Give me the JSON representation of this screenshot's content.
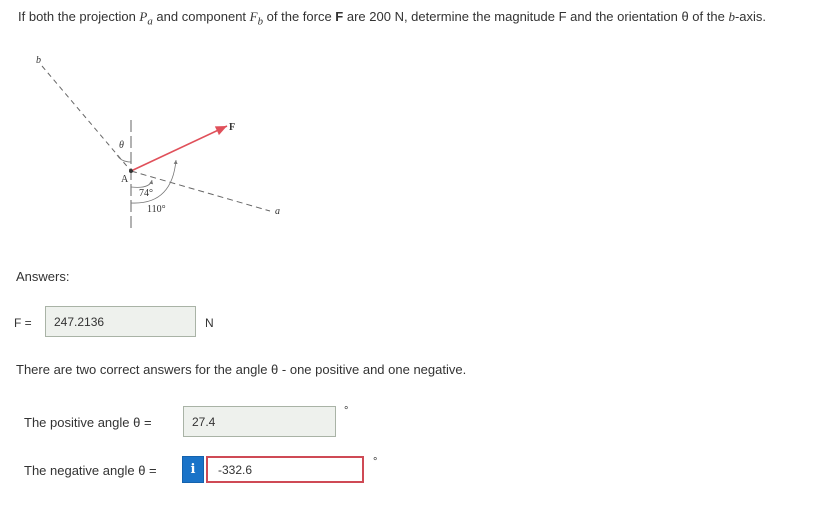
{
  "problem": {
    "part1": "If both the projection ",
    "p_symbol": "P",
    "p_sub": "a",
    "part2": " and component ",
    "f_symbol": "F",
    "f_sub": "b",
    "part3": " of the force ",
    "force_bold": "F",
    "part4": " are 200 N, determine the magnitude F and the orientation θ of the ",
    "b_axis": "b",
    "part5": "-axis."
  },
  "diagram": {
    "label_b": "b",
    "label_a": "a",
    "label_f": "F",
    "label_A": "A",
    "label_theta": "θ",
    "angle_74": "74°",
    "angle_110": "110°",
    "colors": {
      "force": "#e0505a",
      "axis": "#555555"
    }
  },
  "answers_label": "Answers:",
  "f_row": {
    "label": "F =",
    "value": "247.2136",
    "unit": "N"
  },
  "note": "There are two correct answers for the angle θ - one positive and one negative.",
  "positive": {
    "label": "The positive angle θ =",
    "value": "27.4",
    "unit": "°"
  },
  "negative": {
    "label": "The negative angle θ =",
    "value": "-332.6",
    "unit": "°",
    "info_icon": "i"
  },
  "colors": {
    "correct_bg": "#eef1ed",
    "incorrect_border": "#cf4a55",
    "info_blue": "#1a73c8"
  }
}
